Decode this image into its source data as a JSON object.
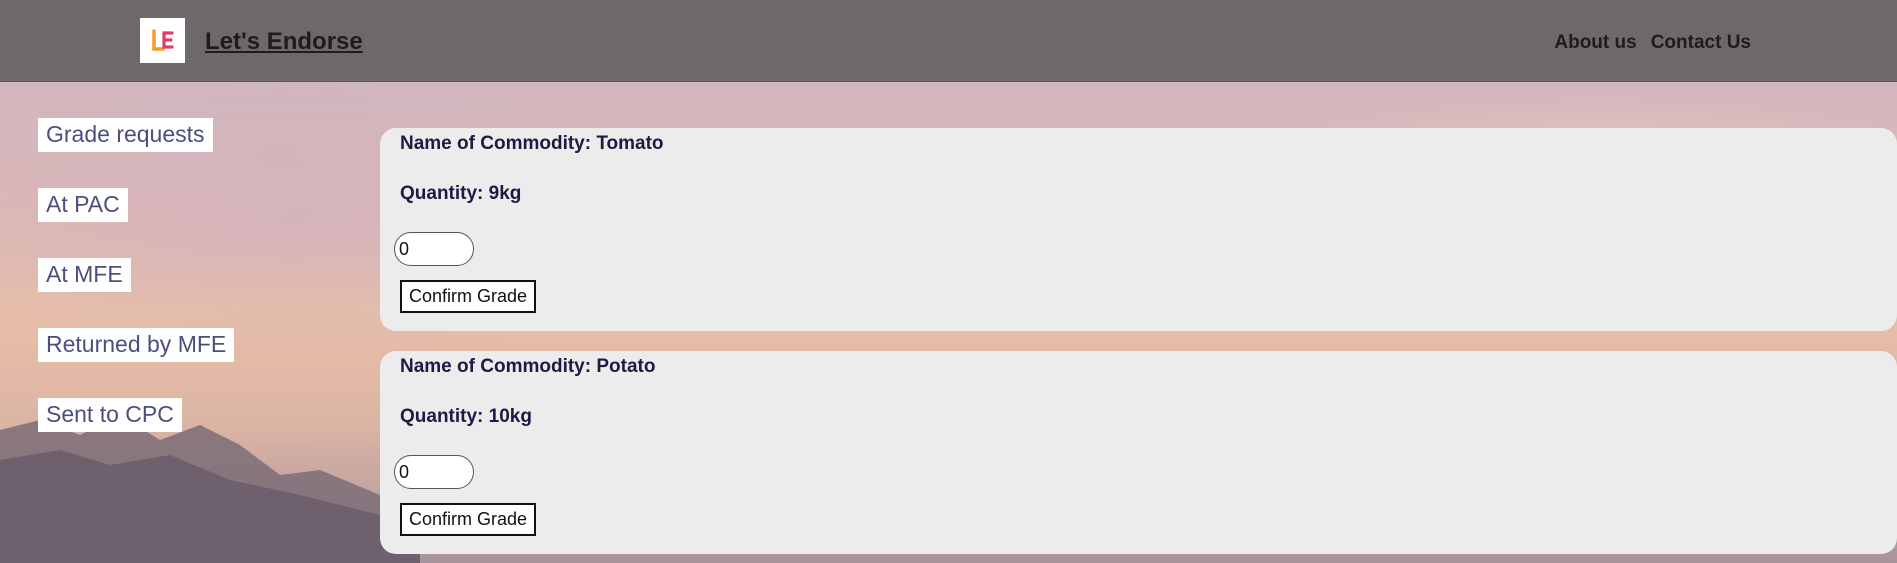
{
  "header": {
    "brand": "Let's Endorse",
    "logo_icon": "le-logo-icon",
    "nav": [
      {
        "label": "About us"
      },
      {
        "label": "Contact Us"
      }
    ]
  },
  "sidebar": {
    "items": [
      {
        "label": "Grade requests"
      },
      {
        "label": "At PAC"
      },
      {
        "label": "At MFE"
      },
      {
        "label": "Returned by MFE"
      },
      {
        "label": "Sent to CPC"
      }
    ]
  },
  "cards": [
    {
      "commodity": "Name of Commodity: Tomato",
      "quantity": "Quantity: 9kg",
      "grade_value": "0",
      "button": "Confirm Grade"
    },
    {
      "commodity": "Name of Commodity: Potato",
      "quantity": "Quantity: 10kg",
      "grade_value": "0",
      "button": "Confirm Grade"
    }
  ],
  "colors": {
    "topbar": "#6f6868",
    "card_bg": "#ececec",
    "sidebar_text": "#4a4f7e"
  }
}
